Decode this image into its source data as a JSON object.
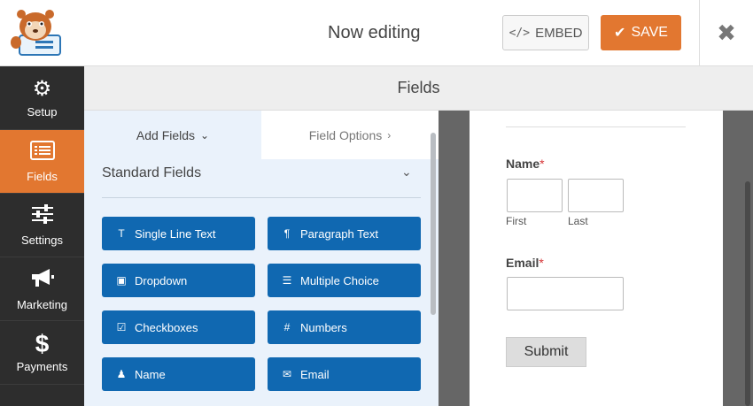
{
  "header": {
    "title": "Now editing",
    "embed_label": "EMBED",
    "save_label": "SAVE"
  },
  "nav": {
    "items": [
      {
        "label": "Setup",
        "icon": "gear-icon"
      },
      {
        "label": "Fields",
        "icon": "list-icon"
      },
      {
        "label": "Settings",
        "icon": "sliders-icon"
      },
      {
        "label": "Marketing",
        "icon": "megaphone-icon"
      },
      {
        "label": "Payments",
        "icon": "dollar-icon"
      }
    ],
    "active": "Fields"
  },
  "fields_header": "Fields",
  "panel": {
    "tabs": [
      {
        "label": "Add Fields"
      },
      {
        "label": "Field Options"
      }
    ],
    "section_title": "Standard Fields",
    "buttons": [
      {
        "label": "Single Line Text",
        "icon": "text-icon"
      },
      {
        "label": "Paragraph Text",
        "icon": "paragraph-icon"
      },
      {
        "label": "Dropdown",
        "icon": "dropdown-icon"
      },
      {
        "label": "Multiple Choice",
        "icon": "list-icon"
      },
      {
        "label": "Checkboxes",
        "icon": "checkbox-icon"
      },
      {
        "label": "Numbers",
        "icon": "hash-icon"
      },
      {
        "label": "Name",
        "icon": "user-icon"
      },
      {
        "label": "Email",
        "icon": "envelope-icon"
      }
    ]
  },
  "preview": {
    "name_label": "Name",
    "required_mark": "*",
    "first_label": "First",
    "last_label": "Last",
    "email_label": "Email",
    "submit_label": "Submit"
  },
  "colors": {
    "accent": "#e27730",
    "field_button": "#1068b1",
    "nav_bg": "#2d2d2d",
    "panel_bg": "#eaf2fb"
  }
}
